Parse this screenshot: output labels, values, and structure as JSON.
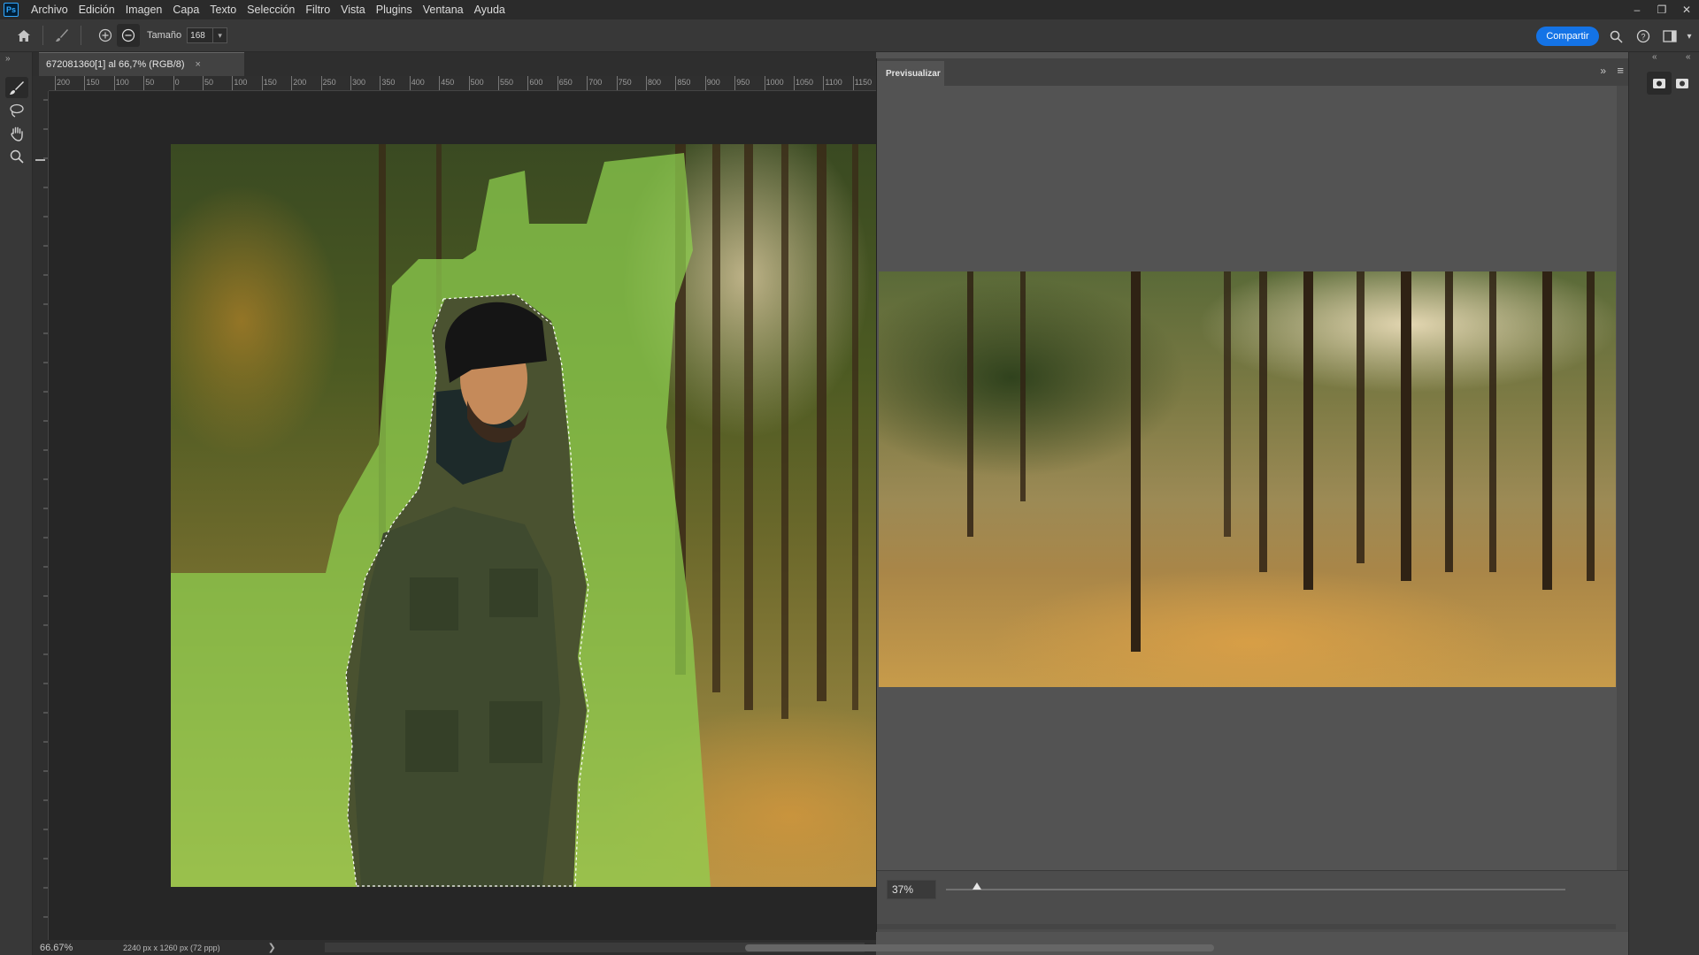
{
  "menubar": {
    "logo": "Ps",
    "items": [
      "Archivo",
      "Edición",
      "Imagen",
      "Capa",
      "Texto",
      "Selección",
      "Filtro",
      "Vista",
      "Plugins",
      "Ventana",
      "Ayuda"
    ],
    "window_controls": [
      "–",
      "❐",
      "✕"
    ]
  },
  "options": {
    "size_label": "Tamaño",
    "size_value": "168",
    "share_label": "Compartir"
  },
  "document": {
    "tab_title": "672081360[1] al 66,7% (RGB/8)",
    "tab_close": "×",
    "ruler_labels": [
      "200",
      "150",
      "100",
      "50",
      "0",
      "50",
      "100",
      "150",
      "200",
      "250",
      "300",
      "350",
      "400",
      "450",
      "500",
      "550",
      "600",
      "650",
      "700",
      "750",
      "800",
      "850",
      "900",
      "950",
      "1000",
      "1050",
      "1100",
      "1150"
    ]
  },
  "status": {
    "zoom": "66.67%",
    "doc_size": "2240 px x 1260 px (72 ppp)",
    "arrow": "❯"
  },
  "preview": {
    "tab_label": "Previsualizar",
    "zoom_value": "37%",
    "zoom_fraction": 0.05
  },
  "icons": {
    "home": "home-icon",
    "brush": "brush-icon",
    "add_mode": "add-mode-icon",
    "subtract_mode": "subtract-mode-icon",
    "search": "search-icon",
    "help": "help-icon",
    "workspace": "workspace-icon"
  },
  "colors": {
    "accent": "#1473e6",
    "mask_overlay": "#8fd14f"
  }
}
